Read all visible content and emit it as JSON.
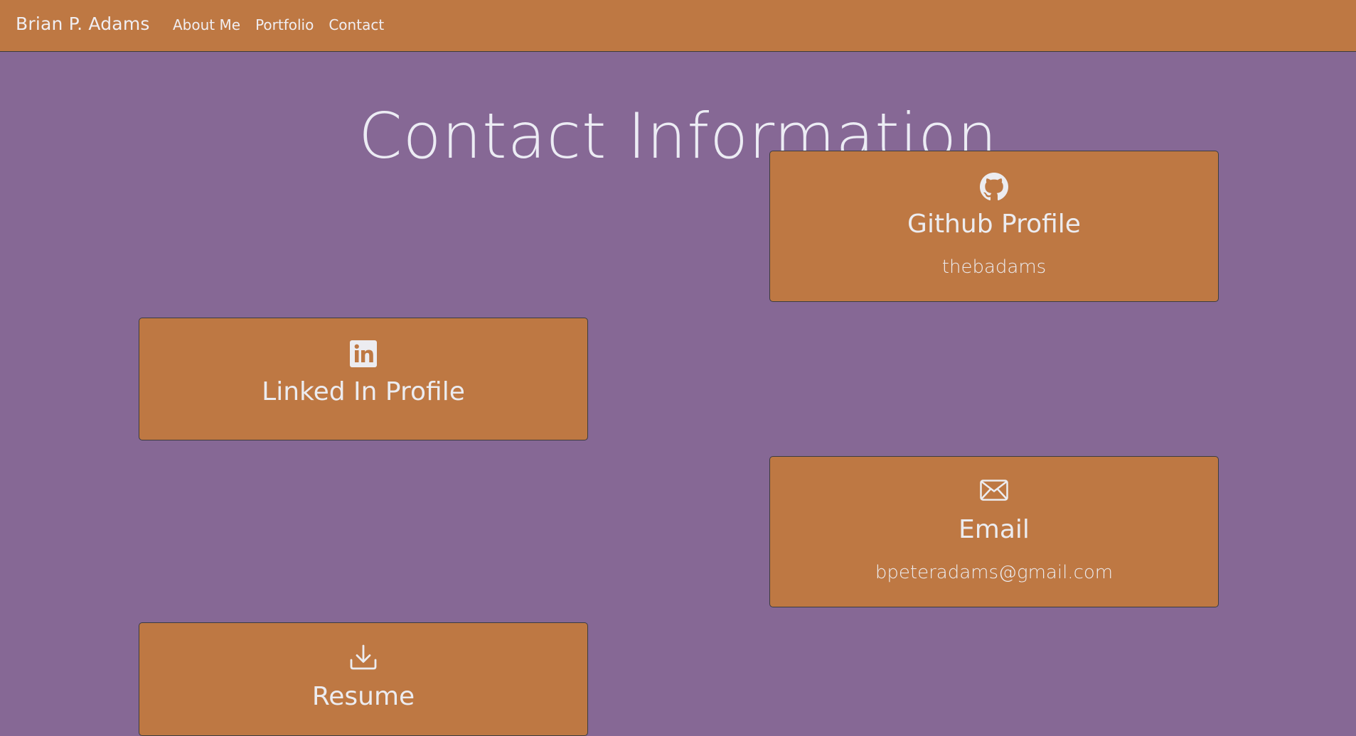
{
  "navbar": {
    "brand": "Brian P. Adams",
    "links": [
      "About Me",
      "Portfolio",
      "Contact"
    ]
  },
  "page": {
    "title": "Contact Information"
  },
  "cards": {
    "github": {
      "icon": "github-icon",
      "title": "Github Profile",
      "subtitle": "thebadams"
    },
    "linkedin": {
      "icon": "linkedin-icon",
      "title": "Linked In Profile"
    },
    "email": {
      "icon": "envelope-icon",
      "title": "Email",
      "subtitle": "bpeteradams@gmail.com"
    },
    "resume": {
      "icon": "download-icon",
      "title": "Resume"
    }
  },
  "colors": {
    "background": "#866895",
    "navbar": "#be7843",
    "card": "#be7843",
    "text": "#ececf0"
  }
}
